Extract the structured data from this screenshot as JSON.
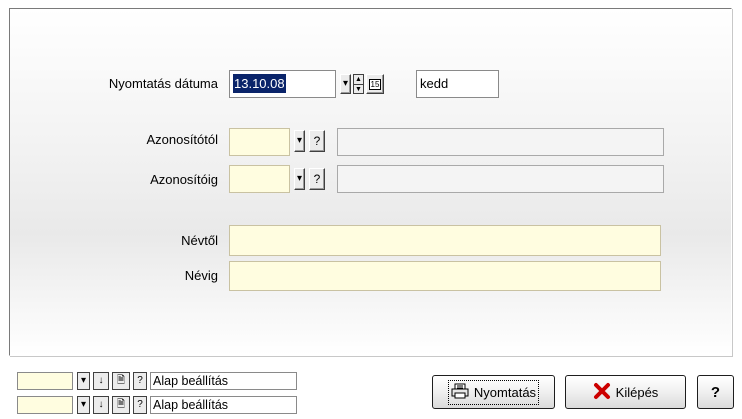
{
  "form": {
    "print_date_label": "Nyomtatás dátuma",
    "print_date_value": "13.10.08",
    "calendar_icon_text": "15",
    "weekday_value": "kedd",
    "id_from_label": "Azonosítótól",
    "id_to_label": "Azonosítóig",
    "name_from_label": "Névtől",
    "name_to_label": "Névig",
    "help_glyph": "?"
  },
  "status_rows": [
    {
      "text": "Alap beállítás"
    },
    {
      "text": "Alap beállítás"
    }
  ],
  "buttons": {
    "print_label": "Nyomtatás",
    "exit_label": "Kilépés",
    "help_label": "?"
  },
  "colors": {
    "selection": "#0a246a",
    "field_yellow": "#fffde0",
    "exit_icon_red": "#cc0000"
  }
}
